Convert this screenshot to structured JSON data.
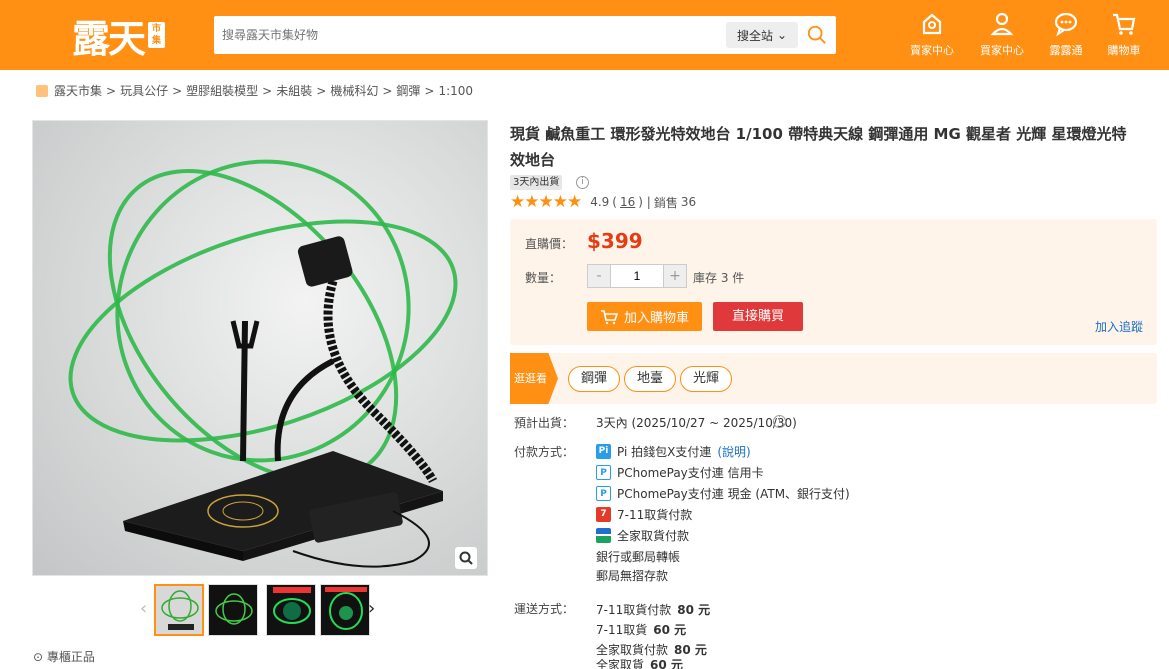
{
  "header": {
    "logo_text": "露天",
    "logo_seal": "市集",
    "search_placeholder": "搜尋露天市集好物",
    "search_scope": "搜全站",
    "nav": [
      {
        "label": "賣家中心",
        "icon": "seller-center-icon"
      },
      {
        "label": "買家中心",
        "icon": "buyer-center-icon"
      },
      {
        "label": "露露通",
        "icon": "chat-icon"
      },
      {
        "label": "購物車",
        "icon": "cart-icon"
      }
    ]
  },
  "breadcrumb": [
    "露天市集",
    "玩具公仔",
    "塑膠組裝模型",
    "未組裝",
    "機械科幻",
    "鋼彈",
    "1:100"
  ],
  "gallery": {
    "badge": "專櫃正品"
  },
  "product": {
    "title": "現貨 鹹魚重工 環形發光特效地台 1/100 帶特典天線 鋼彈通用 MG 觀星者 光輝 星環燈光特效地台",
    "ship_badge": "3天內出貨",
    "rating": "4.9",
    "review_count": "16",
    "sold_label": "銷售",
    "sold_count": "36",
    "price_label": "直購價：",
    "price": "$399",
    "qty_label": "數量：",
    "qty_value": "1",
    "stock": "庫存 3 件",
    "add_cart_label": "加入購物車",
    "buy_now_label": "直接購買",
    "track_label": "加入追蹤"
  },
  "tags": {
    "flag": "逛逛看",
    "items": [
      "鋼彈",
      "地臺",
      "光輝"
    ]
  },
  "details": {
    "ship_label": "預計出貨：",
    "ship_value": "3天內 (2025/10/27 ~ 2025/10/30)",
    "pay_label": "付款方式：",
    "payments": [
      {
        "text": "Pi 拍錢包X支付連",
        "link": "(說明)",
        "icon": "pi-wallet-icon",
        "color": "#2a9de8"
      },
      {
        "text": "PChomePay支付連 信用卡",
        "icon": "pchomepay-card-icon",
        "color": "#2a9de8"
      },
      {
        "text": "PChomePay支付連 現金 (ATM、銀行支付)",
        "icon": "pchomepay-cash-icon",
        "color": "#2a9de8"
      },
      {
        "text": "7-11取貨付款",
        "icon": "seven-eleven-icon",
        "color": "#e43a2a"
      },
      {
        "text": "全家取貨付款",
        "icon": "familymart-icon",
        "color": "#1aa260"
      },
      {
        "text": "銀行或郵局轉帳"
      },
      {
        "text": "郵局無摺存款"
      }
    ],
    "delivery_label": "運送方式：",
    "delivery": [
      {
        "text": "7-11取貨付款",
        "price": "80 元"
      },
      {
        "text": "7-11取貨",
        "price": "60 元"
      },
      {
        "text": "全家取貨付款",
        "price": "80 元"
      },
      {
        "text": "全家取貨",
        "price": "60 元"
      }
    ]
  }
}
